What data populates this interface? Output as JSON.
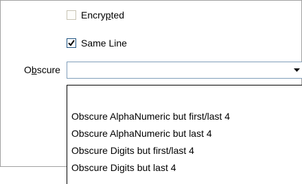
{
  "checkboxes": [
    {
      "label_pre": "Encry",
      "label_u": "p",
      "label_post": "ted",
      "checked": false
    },
    {
      "label_pre": "Same Line",
      "label_u": "",
      "label_post": "",
      "checked": true
    }
  ],
  "obscure": {
    "label_pre": "O",
    "label_u": "b",
    "label_post": "scure",
    "value": ""
  },
  "dropdown_options": [
    "",
    "Obscure AlphaNumeric but first/last 4",
    "Obscure AlphaNumeric but last 4",
    "Obscure Digits but first/last 4",
    "Obscure Digits but last 4"
  ],
  "icons": {
    "dropdown_arrow": "chevron-down-icon",
    "check": "check-icon"
  }
}
